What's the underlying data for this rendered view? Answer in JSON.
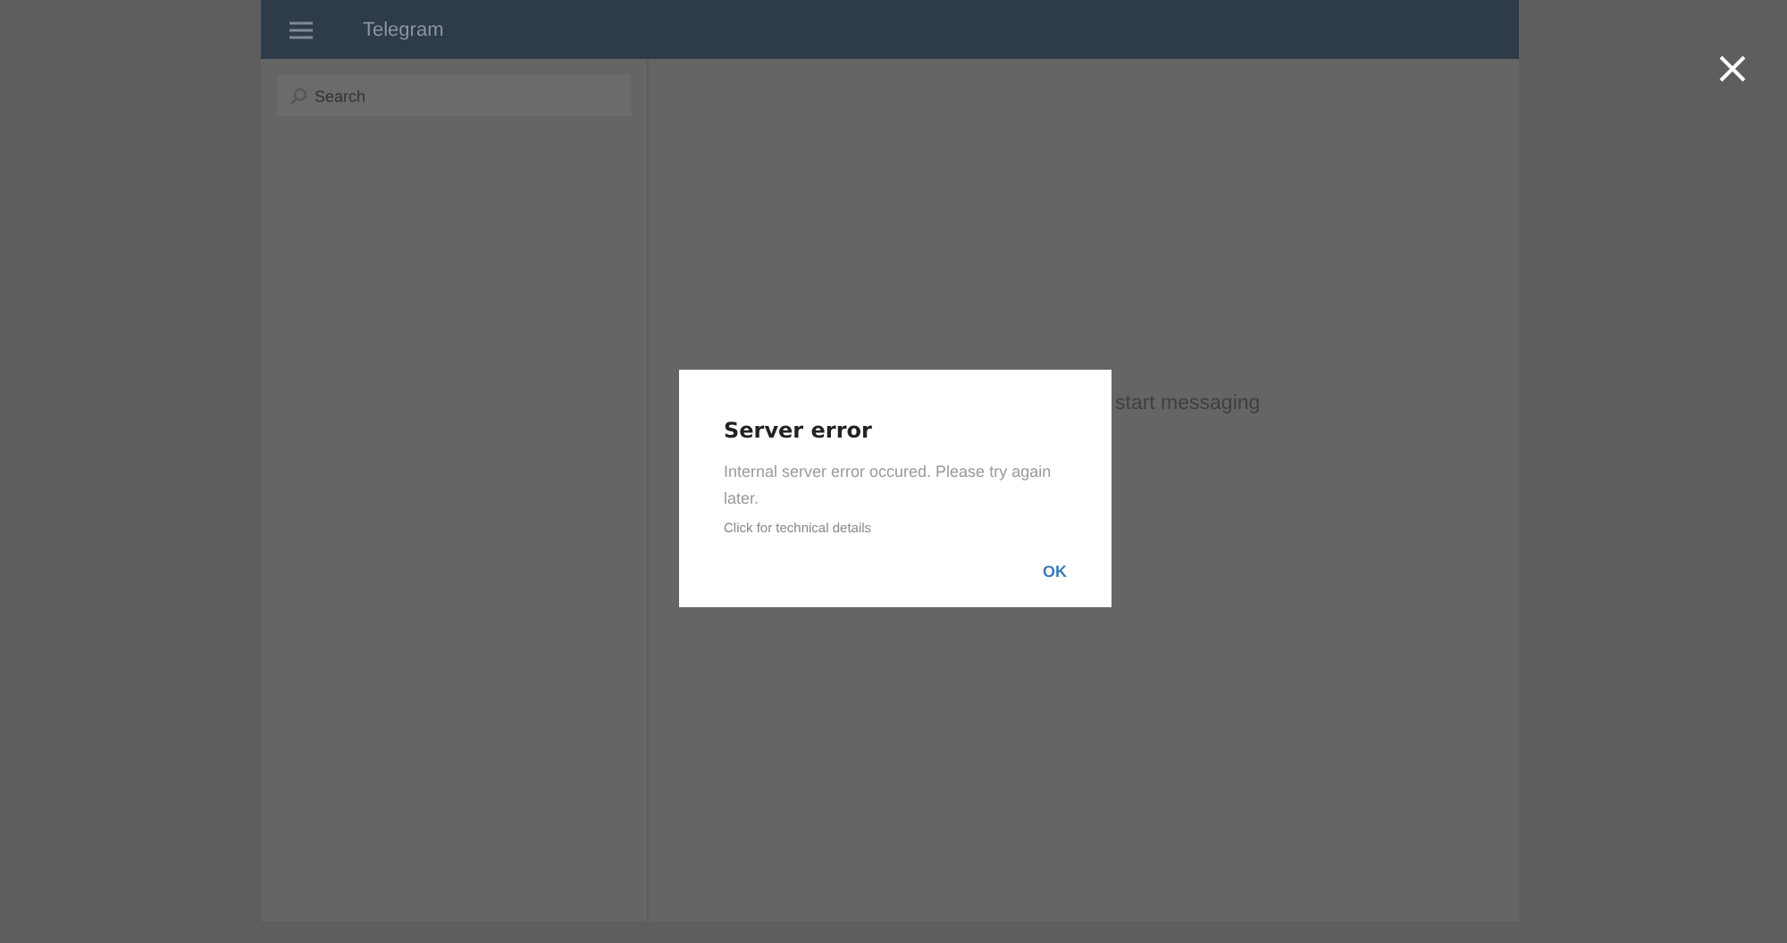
{
  "header": {
    "title": "Telegram"
  },
  "sidebar": {
    "search": {
      "placeholder": "Search"
    }
  },
  "main": {
    "empty_text": "start messaging"
  },
  "dialog": {
    "title": "Server error",
    "message": "Internal server error occured. Please try again later.",
    "details_link": "Click for technical details",
    "buttons": [
      "OK"
    ]
  }
}
